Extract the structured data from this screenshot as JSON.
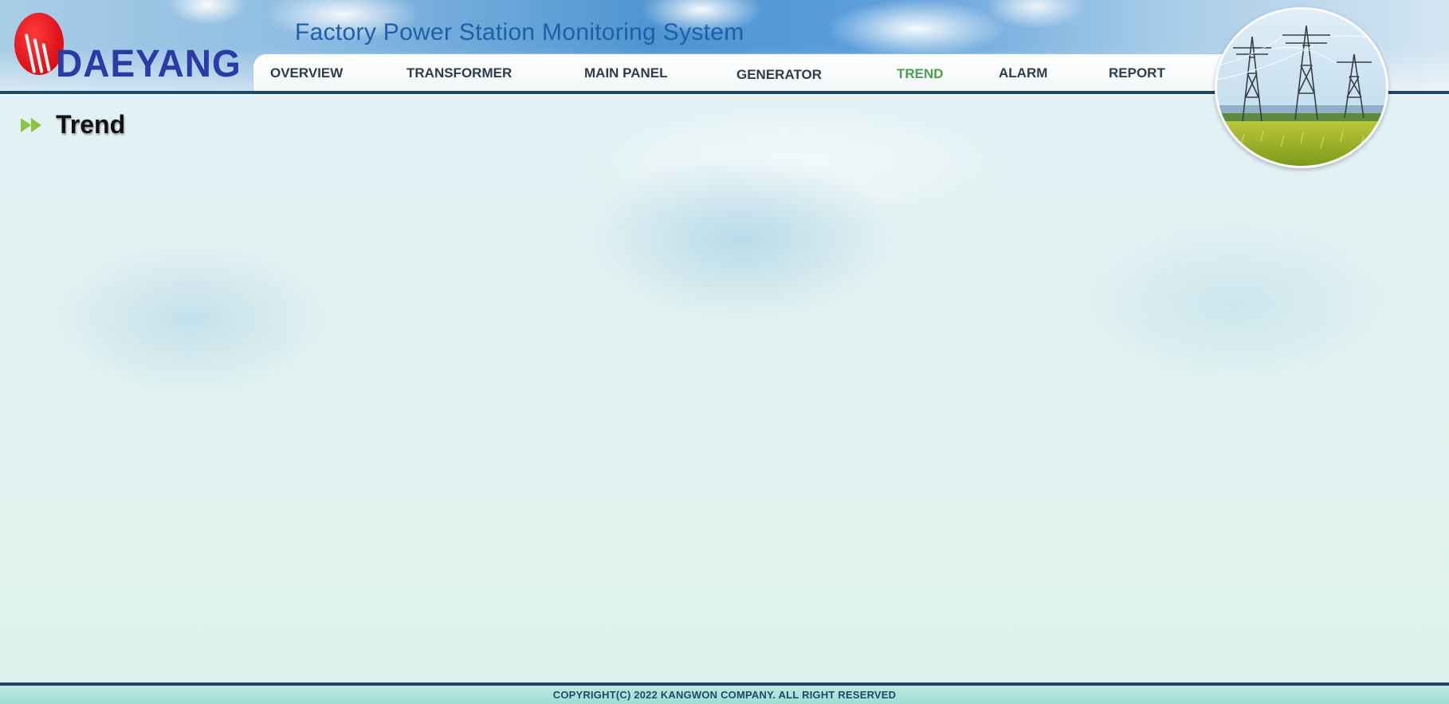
{
  "brand": {
    "name": "DAEYANG",
    "logo_color": "#e0141a",
    "text_color": "#2a3aa6"
  },
  "header": {
    "title": "Factory Power Station Monitoring System"
  },
  "nav": {
    "items": [
      {
        "label": "OVERVIEW",
        "active": false
      },
      {
        "label": "TRANSFORMER",
        "active": false
      },
      {
        "label": "MAIN PANEL",
        "active": false
      },
      {
        "label": "GENERATOR",
        "active": false
      },
      {
        "label": "TREND",
        "active": true
      },
      {
        "label": "ALARM",
        "active": false
      },
      {
        "label": "REPORT",
        "active": false
      }
    ],
    "active_color": "#4aa14a",
    "text_color": "#2c3d4e"
  },
  "header_image": {
    "icon": "power-towers-image"
  },
  "section": {
    "title": "Trend",
    "icon": "double-arrow-icon"
  },
  "footer": {
    "copyright": "COPYRIGHT(C) 2022 KANGWON COMPANY. ALL RIGHT RESERVED"
  },
  "colors": {
    "accent_line": "#1d4a6b",
    "arrow_icon": "#8cc63f"
  }
}
